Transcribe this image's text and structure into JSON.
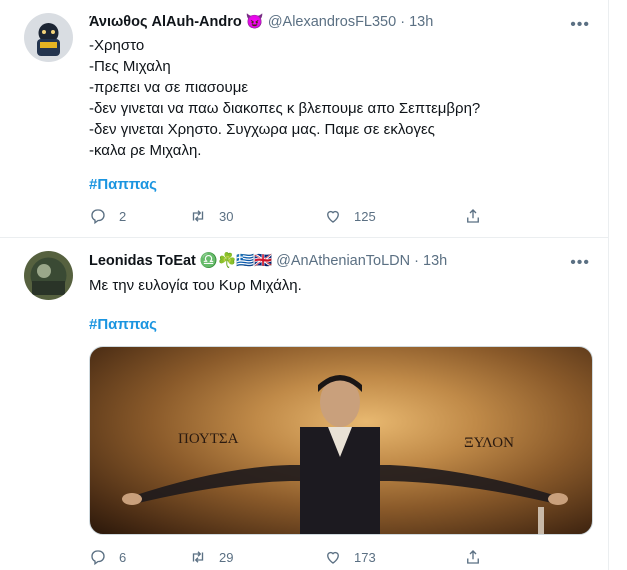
{
  "tweets": [
    {
      "name": "Άνιωθος AlAuh-Andro",
      "name_emoji": "😈",
      "handle": "@AlexandrosFL350 · 13h",
      "lines": [
        "-Χρηστο",
        "-Πες Μιχαλη",
        "-πρεπει να σε πιασουμε",
        "-δεν γινεται να παω διακοπες κ βλεπουμε απο Σεπτεμβρη?",
        "-δεν γινεται Χρηστο. Συγχωρα μας. Παμε σε εκλογες",
        "-καλα ρε Μιχαλη."
      ],
      "hashtag": "#Παππας",
      "replies": "2",
      "retweets": "30",
      "likes": "125"
    },
    {
      "name": "Leonidas ToEat",
      "name_emoji": "♎☘️🇬🇷🇬🇧",
      "handle": "@AnAthenianToLDN · 13h",
      "text": "Με την ευλογία του Κυρ Μιχάλη.",
      "hashtag": "#Παππας",
      "media_text_left": "ΠΟΥΤΣΑ",
      "media_text_right": "ΞΥΛΟΝ",
      "replies": "6",
      "retweets": "29",
      "likes": "173"
    }
  ],
  "colors": {
    "accent": "#1b95e0",
    "secondary": "#5b7083",
    "border": "#ebeef0"
  },
  "icons": [
    "more-icon",
    "reply-icon",
    "retweet-icon",
    "like-icon",
    "share-icon"
  ]
}
